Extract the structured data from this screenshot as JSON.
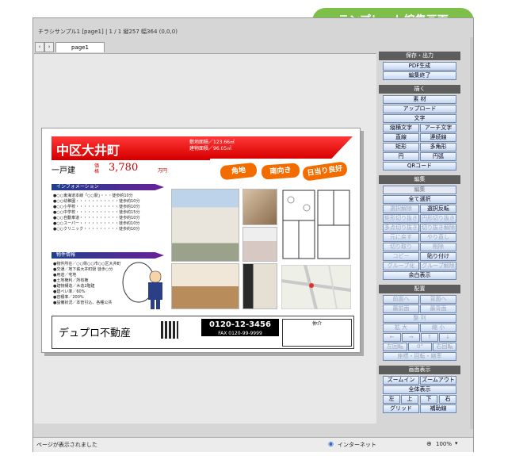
{
  "badge": "テンプレート編集画面",
  "window": {
    "title": "チラシサンプル1 [page1] | 1 / 1  縦257 幅364 (0,0,0)",
    "tab": "page1",
    "status_left": "ページが表示されました",
    "status_zone": "インターネット",
    "status_zoom": "100%"
  },
  "flyer": {
    "town": "中区大井町",
    "area_land": "敷地面積／123.66㎡",
    "area_building": "建物面積／96.05㎡",
    "house_type": "一戸建",
    "price_label": "価格",
    "price": "3,780",
    "price_unit": "万円",
    "tags": [
      "角地",
      "南向き",
      "日当り良好"
    ],
    "info_title": "インフォメーション",
    "info_lines": [
      "●○○東海道本線「○○駅」・・・徒歩約10分",
      "●○○幼稚園・・・・・・・・・・・徒歩約10分",
      "●○○小学校・・・・・・・・・・・徒歩約10分",
      "●○○中学校・・・・・・・・・・・徒歩約15分",
      "●○○自動車道・・・・・・・・・・徒歩約10分",
      "●○○スーパー・・・・・・・・・・徒歩約10分",
      "●○○クリニック・・・・・・・・・徒歩約10分"
    ],
    "detail_title": "物件情報",
    "detail_lines": [
      "●物件所在／○○県○○市○○区大井町",
      "●交通／地下鉄大井町駅 徒歩○分",
      "●用途／宅地",
      "●土地権利／所有権",
      "●建物構造／木造2階建",
      "●建ぺい率／60%",
      "●容積率／200%",
      "●設備状況／本管引込、各種公共"
    ],
    "company": "デュプロ不動産",
    "tel": "0120-12-3456",
    "fax": "FAX 0120-99-9999",
    "broker_title": "仲介"
  },
  "panel": {
    "save_header": "保存・出力",
    "pdf": "PDF生成",
    "end_edit": "編集終了",
    "draw_header": "描く",
    "material": "素 材",
    "upload": "アップロード",
    "text": "文字",
    "vertical_text": "縦横文字",
    "arch_text": "アーチ文字",
    "line": "直線",
    "polyline": "連続線",
    "rect": "矩形",
    "polygon": "多角形",
    "circle": "円",
    "arc": "円弧",
    "qrcode": "QRコード",
    "edit_header": "編集",
    "edit_label": "編集",
    "select_all": "全て選択",
    "deselect": "選択解除",
    "invert_select": "選択反転",
    "rect_cut": "矩形切り抜き",
    "circle_cut": "円形切り抜き",
    "poly_cut": "多点切り抜き",
    "cut_release": "切り抜き解除",
    "restore": "元に戻す",
    "redo": "やり直し",
    "cut": "切り取り",
    "delete": "削除",
    "copy": "コピー",
    "paste": "貼り付け",
    "group": "グループ化",
    "ungroup": "グループ解除",
    "margin_show": "余白表示",
    "arrange_header": "配置",
    "bring_forward": "前面へ",
    "send_backward": "背面へ",
    "bring_front": "最前面",
    "send_back": "最背面",
    "align": "整 列",
    "enlarge": "拡 大",
    "shrink": "縮 小",
    "left_arrow": "←",
    "right_arrow": "→",
    "up_arrow": "↑",
    "down_arrow": "↓",
    "rotate_left": "左回転",
    "rotate_0": "0°",
    "rotate_right": "右回転",
    "coords": "座標・回転・縮率",
    "view_header": "画面表示",
    "zoom_in": "ズームイン",
    "zoom_out": "ズームアウト",
    "fit": "全体表示",
    "move_left": "左",
    "move_up": "上",
    "move_down": "下",
    "move_right": "右",
    "grid": "グリッド",
    "guides": "補助線"
  }
}
